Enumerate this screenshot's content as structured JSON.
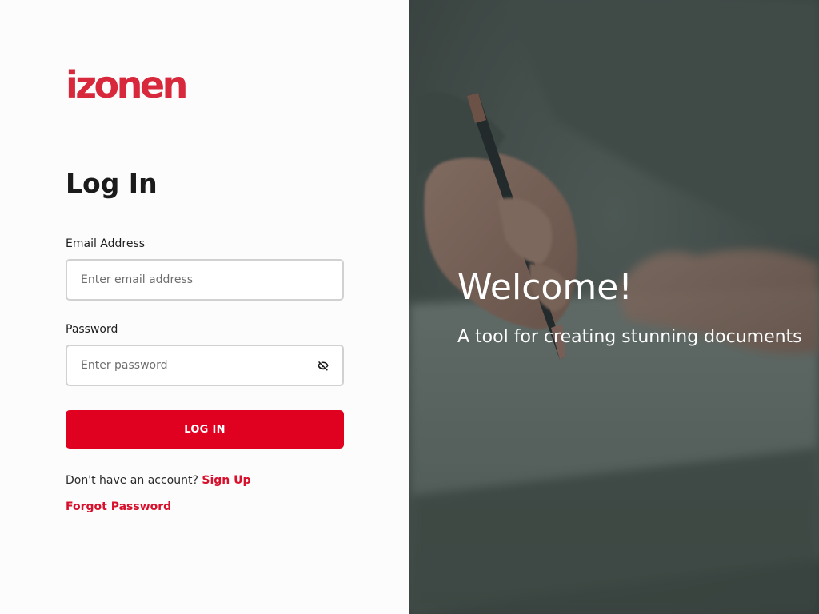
{
  "brand": {
    "logo_text": "izonen",
    "color": "#d8283c"
  },
  "login_form": {
    "title": "Log In",
    "email": {
      "label": "Email Address",
      "placeholder": "Enter email address",
      "value": ""
    },
    "password": {
      "label": "Password",
      "placeholder": "Enter password",
      "value": "",
      "toggle_icon": "eye-off-icon"
    },
    "submit_label": "LOG IN",
    "submit_color": "#e00020",
    "signup_prompt": "Don't have an account?",
    "signup_link": "Sign Up",
    "forgot_link": "Forgot Password",
    "link_color": "#d8102c"
  },
  "hero": {
    "heading": "Welcome!",
    "tagline": "A tool for creating stunning documents"
  }
}
